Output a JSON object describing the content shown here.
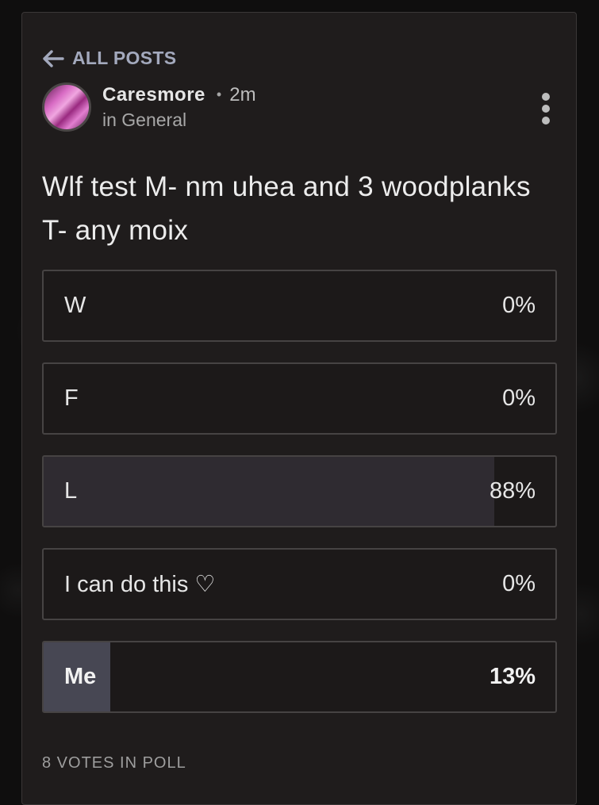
{
  "navigation": {
    "back_label": "ALL POSTS"
  },
  "post": {
    "author": "Caresmore",
    "separator": "•",
    "time": "2m",
    "category": "in General",
    "title": "Wlf test M- nm uhea and 3 woodplanks T- any moix"
  },
  "poll": {
    "options": [
      {
        "label": "W",
        "percent_text": "0%",
        "fill_fraction": 0.0
      },
      {
        "label": "F",
        "percent_text": "0%",
        "fill_fraction": 0.0
      },
      {
        "label": "L",
        "percent_text": "88%",
        "fill_fraction": 0.88
      },
      {
        "label": "I can do this ♡",
        "percent_text": "0%",
        "fill_fraction": 0.0
      },
      {
        "label": "Me",
        "percent_text": "13%",
        "fill_fraction": 0.13,
        "selected": true
      }
    ],
    "votes_text": "8 VOTES IN POLL"
  },
  "icons": {
    "back": "arrow-left-icon",
    "menu": "more-vertical-icon"
  },
  "colors": {
    "card_background": "#1f1c1c",
    "page_background": "#0f0e0e",
    "accent_link": "#a3a9bd",
    "fill_default": "#2f2b31",
    "fill_selected": "#474753"
  }
}
